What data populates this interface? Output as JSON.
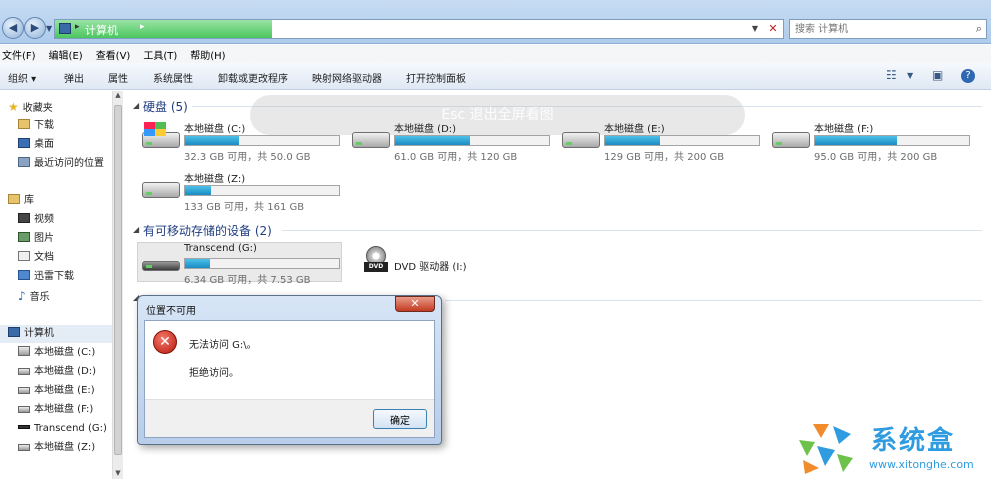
{
  "address": {
    "path": "计算机"
  },
  "search": {
    "placeholder": "搜索 计算机"
  },
  "menu": [
    "文件(F)",
    "编辑(E)",
    "查看(V)",
    "工具(T)",
    "帮助(H)"
  ],
  "toolbar": {
    "organize": "组织 ▾",
    "eject": "弹出",
    "properties": "属性",
    "system_properties": "系统属性",
    "uninstall": "卸载或更改程序",
    "map_drive": "映射网络驱动器",
    "control_panel": "打开控制面板"
  },
  "sidebar": {
    "favorites": {
      "label": "收藏夹",
      "items": [
        "下载",
        "桌面",
        "最近访问的位置"
      ]
    },
    "libraries": {
      "label": "库",
      "items": [
        "视频",
        "图片",
        "文档",
        "迅雷下载",
        "音乐"
      ]
    },
    "computer": {
      "label": "计算机",
      "items": [
        "本地磁盘 (C:)",
        "本地磁盘 (D:)",
        "本地磁盘 (E:)",
        "本地磁盘 (F:)",
        "Transcend (G:)",
        "本地磁盘 (Z:)"
      ]
    }
  },
  "overlay_hint": "Esc 退出全屏看图",
  "sections": {
    "hard_disks": "硬盘 (5)",
    "removable": "有可移动存储的设备 (2)"
  },
  "drives": [
    {
      "label": "本地磁盘 (C:)",
      "info": "32.3 GB 可用，共 50.0 GB",
      "used_fraction": 0.35
    },
    {
      "label": "本地磁盘 (D:)",
      "info": "61.0 GB 可用，共 120 GB",
      "used_fraction": 0.49
    },
    {
      "label": "本地磁盘 (E:)",
      "info": "129 GB 可用，共 200 GB",
      "used_fraction": 0.36
    },
    {
      "label": "本地磁盘 (F:)",
      "info": "95.0 GB 可用，共 200 GB",
      "used_fraction": 0.53
    },
    {
      "label": "本地磁盘 (Z:)",
      "info": "133 GB 可用，共 161 GB",
      "used_fraction": 0.17
    }
  ],
  "removable": [
    {
      "label": "Transcend (G:)",
      "info": "6.34 GB 可用，共 7.53 GB",
      "used_fraction": 0.16
    },
    {
      "label": "DVD 驱动器 (I:)"
    }
  ],
  "dialog": {
    "title": "位置不可用",
    "message": "无法访问 G:\\。",
    "detail": "拒绝访问。",
    "ok": "确定"
  },
  "logo": {
    "name": "系统盒",
    "url": "www.xitonghe.com"
  },
  "colors": {
    "accent": "#1f3d80",
    "bar_fill": "#1a8bc4",
    "error": "#b9180b"
  }
}
